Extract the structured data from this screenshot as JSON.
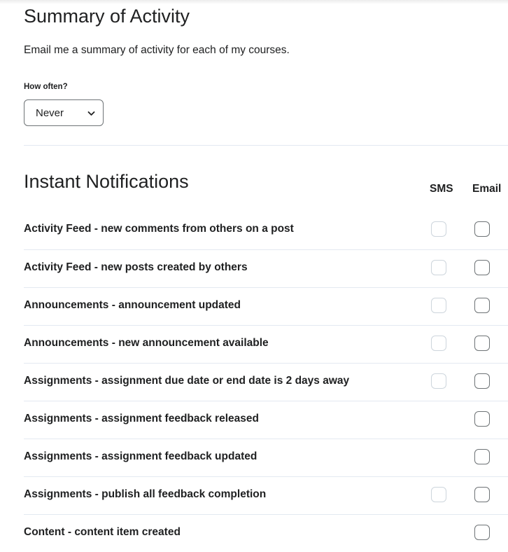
{
  "summary": {
    "title": "Summary of Activity",
    "description": "Email me a summary of activity for each of my courses.",
    "frequency_label": "How often?",
    "frequency_value": "Never"
  },
  "instant": {
    "title": "Instant Notifications",
    "col_sms": "SMS",
    "col_email": "Email",
    "rows": [
      {
        "label": "Activity Feed - new comments from others on a post",
        "sms": true,
        "sms_checked": false,
        "email_checked": false
      },
      {
        "label": "Activity Feed - new posts created by others",
        "sms": true,
        "sms_checked": false,
        "email_checked": false
      },
      {
        "label": "Announcements - announcement updated",
        "sms": true,
        "sms_checked": false,
        "email_checked": false
      },
      {
        "label": "Announcements - new announcement available",
        "sms": true,
        "sms_checked": false,
        "email_checked": false
      },
      {
        "label": "Assignments - assignment due date or end date is 2 days away",
        "sms": true,
        "sms_checked": false,
        "email_checked": false
      },
      {
        "label": "Assignments - assignment feedback released",
        "sms": false,
        "sms_checked": false,
        "email_checked": false
      },
      {
        "label": "Assignments - assignment feedback updated",
        "sms": false,
        "sms_checked": false,
        "email_checked": false
      },
      {
        "label": "Assignments - publish all feedback completion",
        "sms": true,
        "sms_checked": false,
        "email_checked": false
      },
      {
        "label": "Content - content item created",
        "sms": false,
        "sms_checked": false,
        "email_checked": false
      }
    ]
  },
  "colors": {
    "text": "#202122",
    "divider": "#e3e9f1",
    "sms_checkbox_border": "#cdd5dc",
    "email_checkbox_border": "#6e7376"
  },
  "icons": {
    "dropdown": "chevron-down-icon"
  }
}
